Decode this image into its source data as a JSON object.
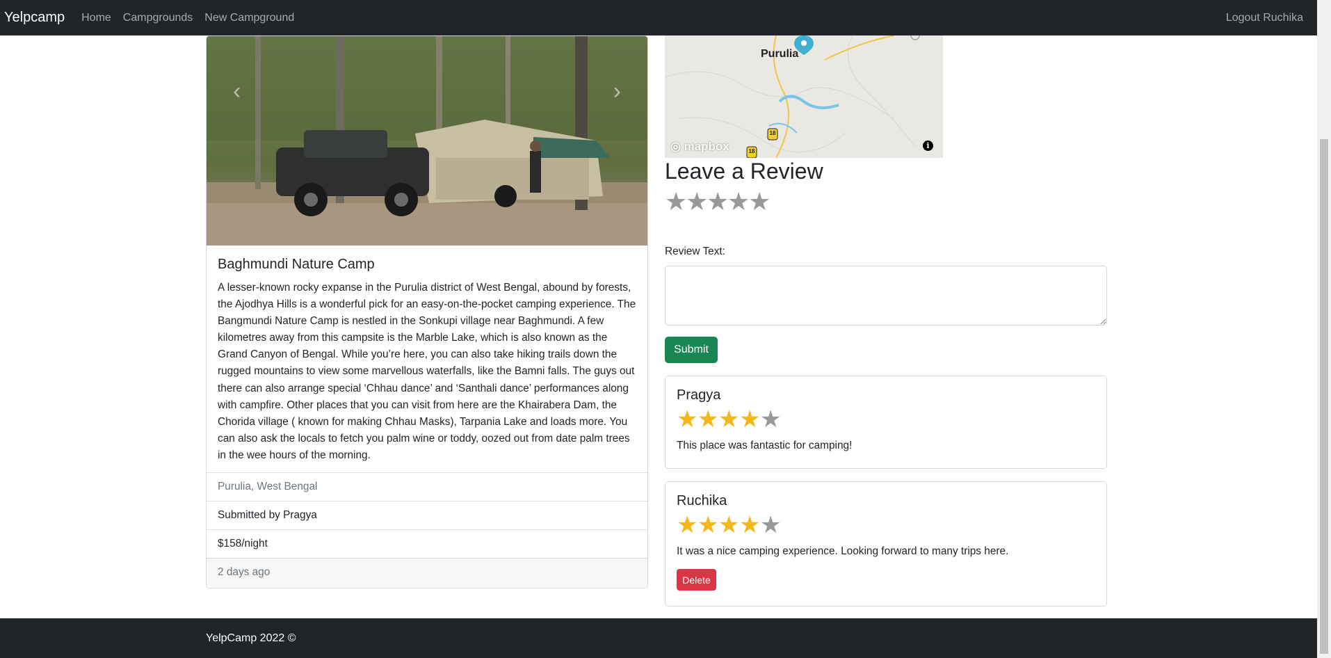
{
  "navbar": {
    "brand": "Yelpcamp",
    "links": [
      "Home",
      "Campgrounds",
      "New Campground"
    ],
    "logout": "Logout Ruchika"
  },
  "campground": {
    "title": "Baghmundi Nature Camp",
    "description": "A lesser-known rocky expanse in the Purulia district of West Bengal, abound by forests, the Ajodhya Hills is a wonderful pick for an easy-on-the-pocket camping experience. The Bangmundi Nature Camp is nestled in the Sonkupi village near Baghmundi. A few kilometres away from this campsite is the Marble Lake, which is also known as the Grand Canyon of Bengal. While you’re here, you can also take hiking trails down the rugged mountains to view some marvellous waterfalls, like the Bamni falls. The guys out there can also arrange special ‘Chhau dance’ and ‘Santhali dance’ performances along with campfire. Other places that you can visit from here are the Khairabera Dam, the Chorida village ( known for making Chhau Masks), Tarpania Lake and loads more. You can also ask the locals to fetch you palm wine or toddy, oozed out from date palm trees in the wee hours of the morning.",
    "location": "Purulia, West Bengal",
    "submitted_by": "Submitted by Pragya",
    "price": "$158/night",
    "posted": "2 days ago"
  },
  "map": {
    "city_label": "Purulia",
    "logo_text": "mapbox",
    "info_icon": "i",
    "road_shields": [
      "18",
      "18"
    ]
  },
  "review_form": {
    "heading": "Leave a Review",
    "rating": 0,
    "star_count": 5,
    "label": "Review Text:",
    "submit_label": "Submit"
  },
  "reviews": [
    {
      "author": "Pragya",
      "rating": 4,
      "text": "This place was fantastic for camping!"
    },
    {
      "author": "Ruchika",
      "rating": 4,
      "text": "It was a nice camping experience. Looking forward to many trips here.",
      "delete_label": "Delete"
    }
  ],
  "colors": {
    "navbar": "#212529",
    "success": "#198754",
    "danger": "#dc3545",
    "star_on": "#f3b718",
    "star_off": "#999999"
  },
  "footer": {
    "text": "YelpCamp 2022 ©"
  }
}
